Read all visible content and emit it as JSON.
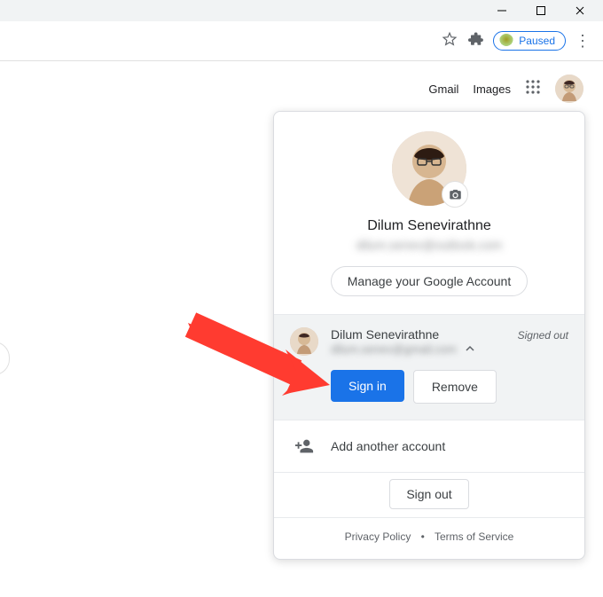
{
  "chrome": {
    "paused_label": "Paused"
  },
  "gheader": {
    "gmail": "Gmail",
    "images": "Images"
  },
  "popup": {
    "name": "Dilum Senevirathne",
    "email": "dilum.senev@outlook.com",
    "manage": "Manage your Google Account",
    "other_accounts": [
      {
        "name": "Dilum Senevirathne",
        "email": "dilum.senev@gmail.com",
        "status": "Signed out"
      }
    ],
    "sign_in": "Sign in",
    "remove": "Remove",
    "add_another": "Add another account",
    "sign_out": "Sign out",
    "privacy": "Privacy Policy",
    "terms": "Terms of Service"
  }
}
